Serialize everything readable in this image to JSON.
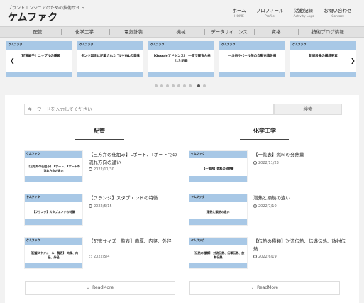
{
  "header": {
    "tagline": "プラントエンジニアのための技術サイト",
    "title": "ケムファク",
    "nav": [
      {
        "label": "ホーム",
        "sub": "HOME"
      },
      {
        "label": "プロフィール",
        "sub": "Profile"
      },
      {
        "label": "活動記録",
        "sub": "Activity Logs"
      },
      {
        "label": "お問い合わせ",
        "sub": "Contact"
      }
    ]
  },
  "categories": [
    "配管",
    "化学工学",
    "電気計装",
    "機械",
    "データサイエンス",
    "資格",
    "技術ブログ情報"
  ],
  "carousel": {
    "slides": [
      {
        "brand": "ケムファク",
        "title": "【配管継手】ニップルの種類"
      },
      {
        "brand": "ケムファク",
        "title": "タンク図面に記載された TLやWLの意味"
      },
      {
        "brand": "ケムファク",
        "title": "【Googleアドセンス】 一発で審査合格した記録"
      },
      {
        "brand": "ケムファク",
        "title": "一斗缶やペール缶の自動充填設備"
      },
      {
        "brand": "ケムファク",
        "title": "蒸留設備の構成要素"
      }
    ],
    "prev_icon": "chevron-left-icon",
    "next_icon": "chevron-right-icon",
    "dot_count": 9,
    "active_dot": 7
  },
  "search": {
    "placeholder": "キーワードを入力してください",
    "button_label": "検索"
  },
  "columns": [
    {
      "title": "配管",
      "posts": [
        {
          "brand": "ケムファク",
          "thumb": "【三方弁の仕組み】 Lポート、Tポートの流れ方向の違い",
          "title": "【三方弁の仕組み】Lポート、Tポートでの流れ方向の違い",
          "date": "2022/11/30"
        },
        {
          "brand": "ケムファク",
          "thumb": "【フランジ】スタブエンドの特徴",
          "title": "【フランジ】スタブエンドの特徴",
          "date": "2022/5/15"
        },
        {
          "brand": "ケムファク",
          "thumb": "【配管スケジュール一覧表】 肉厚、内径、外径",
          "title": "【配管サイズ一覧表】肉厚、内径、外径",
          "date": "2022/5/4"
        }
      ],
      "readmore": "ReadMore"
    },
    {
      "title": "化学工学",
      "posts": [
        {
          "brand": "ケムファク",
          "thumb": "【一覧表】燃料の発熱量",
          "title": "【一覧表】燃料の発熱量",
          "date": "2022/11/23"
        },
        {
          "brand": "ケムファク",
          "thumb": "潜熱と顕熱の違い",
          "title": "潜熱と顕熱の違い",
          "date": "2022/7/10"
        },
        {
          "brand": "ケムファク",
          "thumb": "【伝熱の種類】 対流伝熱、伝導伝熱、放射伝熱",
          "title": "【伝熱の種類】対流伝熱、伝導伝熱、放射伝熱",
          "date": "2022/6/19"
        }
      ],
      "readmore": "ReadMore"
    }
  ]
}
